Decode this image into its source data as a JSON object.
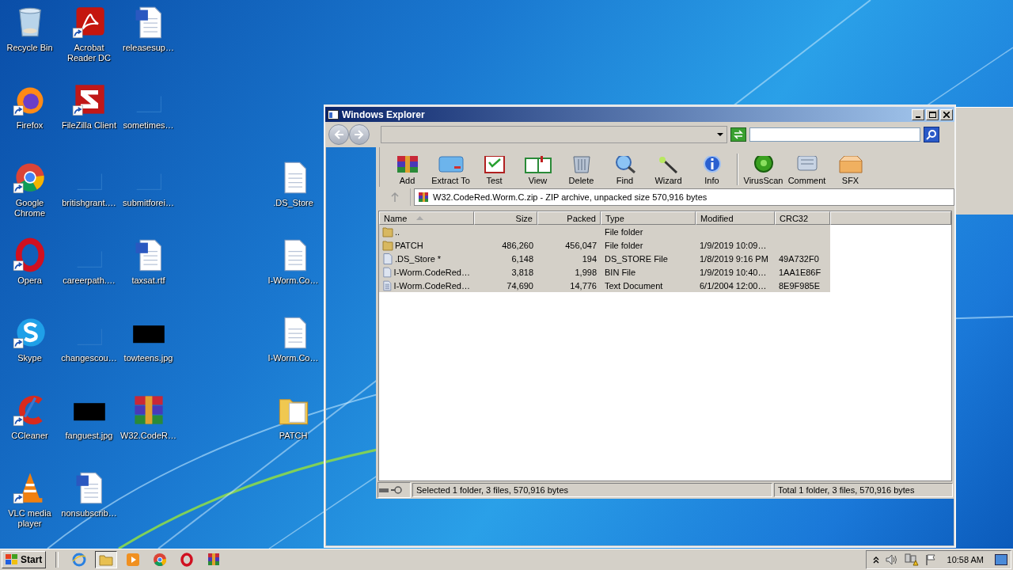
{
  "desktop": {
    "columns": [
      [
        {
          "label": "Recycle Bin",
          "kind": "recycle",
          "shortcut": false
        },
        {
          "label": "Firefox",
          "kind": "firefox",
          "shortcut": true
        },
        {
          "label": "Google Chrome",
          "kind": "chrome",
          "shortcut": true
        },
        {
          "label": "Opera",
          "kind": "opera",
          "shortcut": true
        },
        {
          "label": "Skype",
          "kind": "skype",
          "shortcut": true
        },
        {
          "label": "CCleaner",
          "kind": "ccleaner",
          "shortcut": true
        },
        {
          "label": "VLC media player",
          "kind": "vlc",
          "shortcut": true
        }
      ],
      [
        {
          "label": "Acrobat Reader DC",
          "kind": "acrobat",
          "shortcut": true
        },
        {
          "label": "FileZilla Client",
          "kind": "filezilla",
          "shortcut": true
        },
        {
          "label": "britishgrant.…",
          "kind": "blank",
          "shortcut": false
        },
        {
          "label": "careerpath.…",
          "kind": "blank",
          "shortcut": false
        },
        {
          "label": "changescou…",
          "kind": "blank",
          "shortcut": false
        },
        {
          "label": "fanguest.jpg",
          "kind": "image",
          "shortcut": false
        },
        {
          "label": "nonsubscrib…",
          "kind": "word",
          "shortcut": false
        }
      ],
      [
        {
          "label": "releasesup…",
          "kind": "word",
          "shortcut": false
        },
        {
          "label": "sometimes…",
          "kind": "blank",
          "shortcut": false
        },
        {
          "label": "submitforei…",
          "kind": "blank",
          "shortcut": false
        },
        {
          "label": "taxsat.rtf",
          "kind": "word",
          "shortcut": false
        },
        {
          "label": "towteens.jpg",
          "kind": "image",
          "shortcut": false
        },
        {
          "label": "W32.CodeR…",
          "kind": "winrar",
          "shortcut": false
        }
      ],
      [
        {
          "label": ".DS_Store",
          "kind": "document",
          "shortcut": false
        },
        {
          "label": "I-Worm.Co…",
          "kind": "document",
          "shortcut": false
        },
        {
          "label": "I-Worm.Co…",
          "kind": "document",
          "shortcut": false
        },
        {
          "label": "PATCH",
          "kind": "folder",
          "shortcut": false
        }
      ]
    ]
  },
  "window": {
    "title": "Windows Explorer"
  },
  "toolbar": [
    {
      "label": "Add",
      "kind": "add"
    },
    {
      "label": "Extract To",
      "kind": "extract"
    },
    {
      "label": "Test",
      "kind": "test"
    },
    {
      "label": "View",
      "kind": "view"
    },
    {
      "label": "Delete",
      "kind": "delete"
    },
    {
      "label": "Find",
      "kind": "find"
    },
    {
      "label": "Wizard",
      "kind": "wizard"
    },
    {
      "label": "Info",
      "kind": "info"
    },
    {
      "label": "VirusScan",
      "kind": "virusscan"
    },
    {
      "label": "Comment",
      "kind": "comment"
    },
    {
      "label": "SFX",
      "kind": "sfx"
    }
  ],
  "path": "W32.CodeRed.Worm.C.zip - ZIP archive, unpacked size 570,916 bytes",
  "file_list": {
    "columns": [
      {
        "label": "Name",
        "sorted": true
      },
      {
        "label": "Size",
        "sorted": false
      },
      {
        "label": "Packed",
        "sorted": false
      },
      {
        "label": "Type",
        "sorted": false
      },
      {
        "label": "Modified",
        "sorted": false
      },
      {
        "label": "CRC32",
        "sorted": false
      }
    ],
    "rows": [
      {
        "kind": "folder",
        "name": "..",
        "type": "File folder",
        "selected": true
      },
      {
        "kind": "folder",
        "name": "PATCH",
        "size": "486,260",
        "packed": "456,047",
        "type": "File folder",
        "modified": "1/9/2019 10:09…",
        "selected": true
      },
      {
        "kind": "file",
        "name": ".DS_Store *",
        "size": "6,148",
        "packed": "194",
        "type": "DS_STORE File",
        "modified": "1/8/2019 9:16 PM",
        "crc": "49A732F0",
        "selected": true
      },
      {
        "kind": "file",
        "name": "I-Worm.CodeRed…",
        "size": "3,818",
        "packed": "1,998",
        "type": "BIN File",
        "modified": "1/9/2019 10:40…",
        "crc": "1AA1E86F",
        "selected": true
      },
      {
        "kind": "text",
        "name": "I-Worm.CodeRed…",
        "size": "74,690",
        "packed": "14,776",
        "type": "Text Document",
        "modified": "6/1/2004 12:00…",
        "crc": "8E9F985E",
        "selected": true
      }
    ]
  },
  "status_bar": {
    "selection": "Selected 1 folder, 3 files, 570,916 bytes",
    "total": "Total 1 folder, 3 files, 570,916 bytes"
  },
  "taskbar": {
    "start": "Start",
    "buttons": [
      {
        "kind": "ie",
        "selected": false
      },
      {
        "kind": "explorer",
        "selected": true
      },
      {
        "kind": "media",
        "selected": false
      },
      {
        "kind": "chrome",
        "selected": false
      },
      {
        "kind": "opera",
        "selected": false
      },
      {
        "kind": "winrar",
        "selected": false
      }
    ],
    "time": "10:58 AM"
  }
}
